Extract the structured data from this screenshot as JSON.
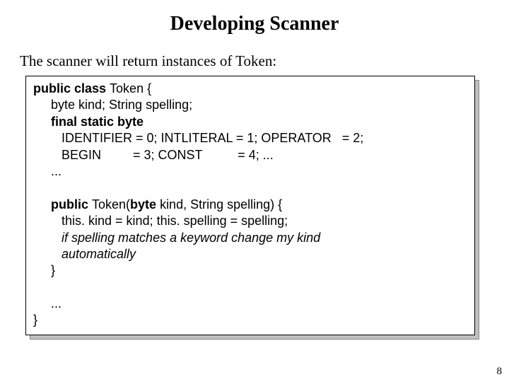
{
  "title": "Developing Scanner",
  "intro": "The scanner will return instances of Token:",
  "code": {
    "l1a": "public class ",
    "l1b": "Token { ",
    "l2": "     byte kind; String spelling;",
    "l3": "     final static byte ",
    "l4": "        IDENTIFIER = 0; INTLITERAL = 1; OPERATOR   = 2;",
    "l5": "        BEGIN         = 3; CONST          = 4; ...",
    "l6": "     ...",
    "blank1": " ",
    "l7a": "     public ",
    "l7b": "Token(",
    "l7c": "byte ",
    "l7d": "kind, String spelling) { ",
    "l8": "        this. kind = kind; this. spelling = spelling;",
    "l9": "        if spelling matches a keyword change my kind",
    "l10": "        automatically",
    "l11": "     }",
    "blank2": " ",
    "l12": "     ...",
    "l13": "}"
  },
  "page_number": "8"
}
